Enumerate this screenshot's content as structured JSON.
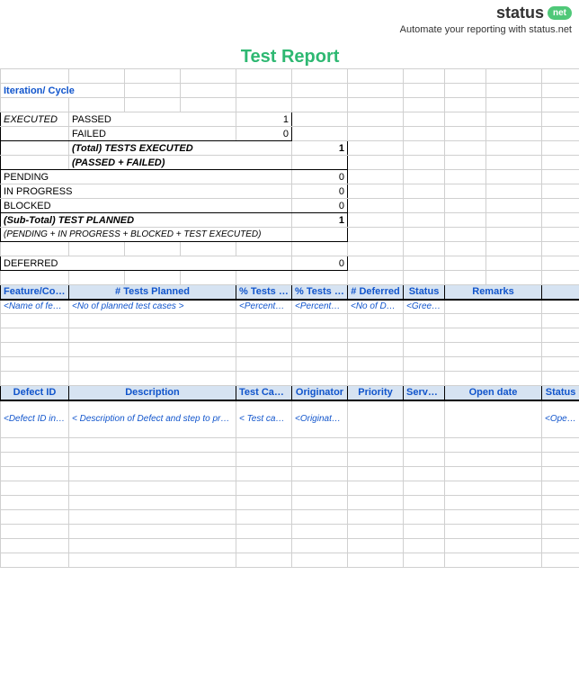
{
  "brand": {
    "name": "status",
    "badge": "net",
    "tagline": "Automate your reporting with status.net"
  },
  "title": "Test Report",
  "iteration_label": "Iteration/ Cycle",
  "summary": {
    "executed_label": "EXECUTED",
    "passed": {
      "label": "PASSED",
      "value": "1"
    },
    "failed": {
      "label": "FAILED",
      "value": "0"
    },
    "total_exec": {
      "label": "(Total) TESTS EXECUTED",
      "formula": "(PASSED + FAILED)",
      "value": "1"
    },
    "pending": {
      "label": "PENDING",
      "value": "0"
    },
    "inprogress": {
      "label": "IN PROGRESS",
      "value": "0"
    },
    "blocked": {
      "label": "BLOCKED",
      "value": "0"
    },
    "subtotal": {
      "label": "(Sub-Total) TEST PLANNED",
      "formula": "(PENDING + IN PROGRESS + BLOCKED + TEST  EXECUTED)",
      "value": "1"
    },
    "deferred": {
      "label": "DEFERRED",
      "value": "0"
    }
  },
  "features_table": {
    "headers": [
      "Feature/Components",
      "# Tests Planned",
      "% Tests Executed",
      "% Tests Passed",
      "# Deferred",
      "Status",
      "Remarks"
    ],
    "hints": [
      "<Name of feature/type>",
      "<No of  planned test cases >",
      "<Percentage of executed test cases>",
      "<Percentage test cases of executed test case that passed>",
      "<No of Deferred test cases >",
      "<Green/ Red/ Yellow>",
      ""
    ]
  },
  "defects_table": {
    "headers": [
      "Defect ID",
      "Description",
      "Test Case ID",
      "Originator",
      "Priority",
      "Serverity",
      "Open date",
      "Status"
    ],
    "hints": [
      "<Defect ID in defect tracking tool>",
      "< Description of Defect and step to preproduce the defect>",
      "< Test case ID>",
      "<Originator of Defect>",
      "",
      "",
      "",
      "<Open Close>"
    ]
  }
}
